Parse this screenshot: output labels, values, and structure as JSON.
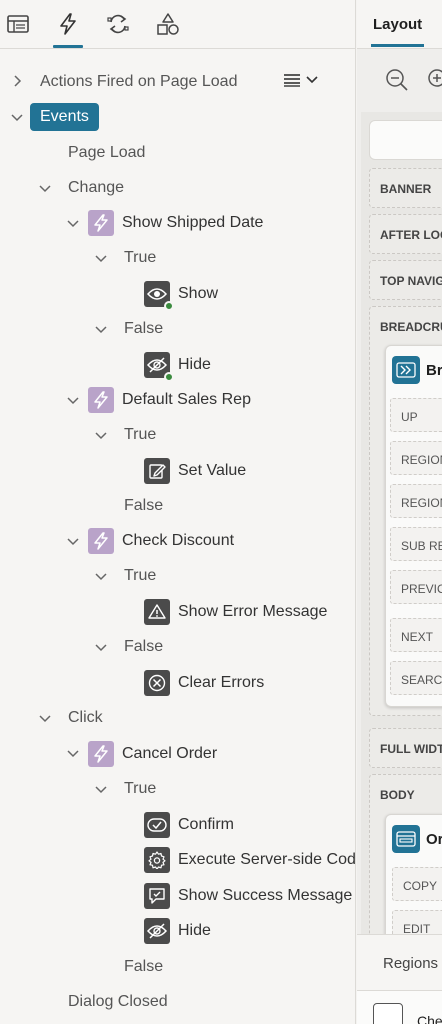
{
  "left_tabs": [
    {
      "name": "rendering-tab",
      "icon": "layout-icon",
      "active": false
    },
    {
      "name": "dynamic-actions-tab",
      "icon": "lightning-icon",
      "active": true
    },
    {
      "name": "processing-tab",
      "icon": "refresh-icon",
      "active": false
    },
    {
      "name": "shared-components-tab",
      "icon": "shapes-icon",
      "active": false
    }
  ],
  "tree": {
    "actions_on_load": "Actions Fired on Page Load",
    "events": "Events",
    "page_load": "Page Load",
    "change": "Change",
    "show_shipped_date": "Show Shipped Date",
    "true1": "True",
    "show": "Show",
    "false1": "False",
    "hide1": "Hide",
    "default_sales_rep": "Default Sales Rep",
    "true2": "True",
    "set_value": "Set Value",
    "false2": "False",
    "check_discount": "Check Discount",
    "true3": "True",
    "show_error": "Show Error Message",
    "false3": "False",
    "clear_errors": "Clear Errors",
    "click": "Click",
    "cancel_order": "Cancel Order",
    "true4": "True",
    "confirm": "Confirm",
    "exec_server": "Execute Server-side Code",
    "show_success": "Show Success Message",
    "hide2": "Hide",
    "false4": "False",
    "dialog_closed": "Dialog Closed"
  },
  "right": {
    "tab": "Layout",
    "positions": {
      "banner": "BANNER",
      "after_logo": "AFTER LOGO",
      "top_nav": "TOP NAVIGATION",
      "breadcrumb": "BREADCRUMB",
      "full_width": "FULL WIDTH CONTENT",
      "body": "BODY"
    },
    "breadcrumb_region": {
      "title": "Breadcrumb",
      "slots": [
        "UP",
        "REGION",
        "REGION",
        "SUB REGIONS",
        "PREVIOUS",
        "NEXT",
        "SEARCH"
      ]
    },
    "body_region": {
      "title": "Order",
      "slots": [
        "COPY",
        "EDIT"
      ]
    },
    "bottom_tab": "Regions",
    "bottom_item": "Check"
  },
  "colors": {
    "accent": "#227395",
    "da_icon": "#b9a3c9",
    "action_icon": "#4b4b4b",
    "ok_badge": "#3a8a3e"
  }
}
